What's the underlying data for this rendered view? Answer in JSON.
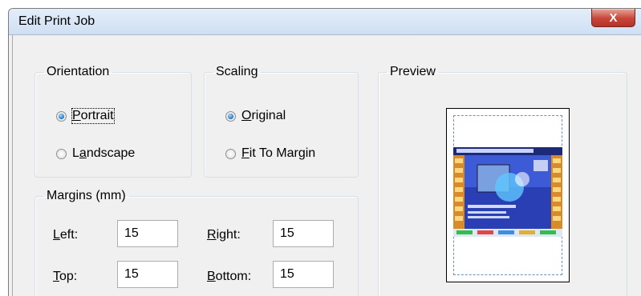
{
  "window": {
    "title": "Edit Print Job",
    "close_label": "X"
  },
  "orientation": {
    "legend": "Orientation",
    "options": [
      {
        "label_u": "P",
        "label_rest": "ortrait",
        "checked": true
      },
      {
        "label_pre": "L",
        "label_u": "a",
        "label_rest": "ndscape",
        "checked": false
      }
    ]
  },
  "scaling": {
    "legend": "Scaling",
    "options": [
      {
        "label_u": "O",
        "label_rest": "riginal",
        "checked": true
      },
      {
        "label_u": "F",
        "label_rest": "it To Margin",
        "checked": false
      }
    ]
  },
  "margins": {
    "legend": "Margins (mm)",
    "left": {
      "label_u": "L",
      "label_rest": "eft:",
      "value": "15"
    },
    "right": {
      "label_u": "R",
      "label_rest": "ight:",
      "value": "15"
    },
    "top": {
      "label_u": "T",
      "label_rest": "op:",
      "value": "15"
    },
    "bottom": {
      "label_u": "B",
      "label_rest": "ottom:",
      "value": "15"
    }
  },
  "preview": {
    "legend": "Preview"
  }
}
